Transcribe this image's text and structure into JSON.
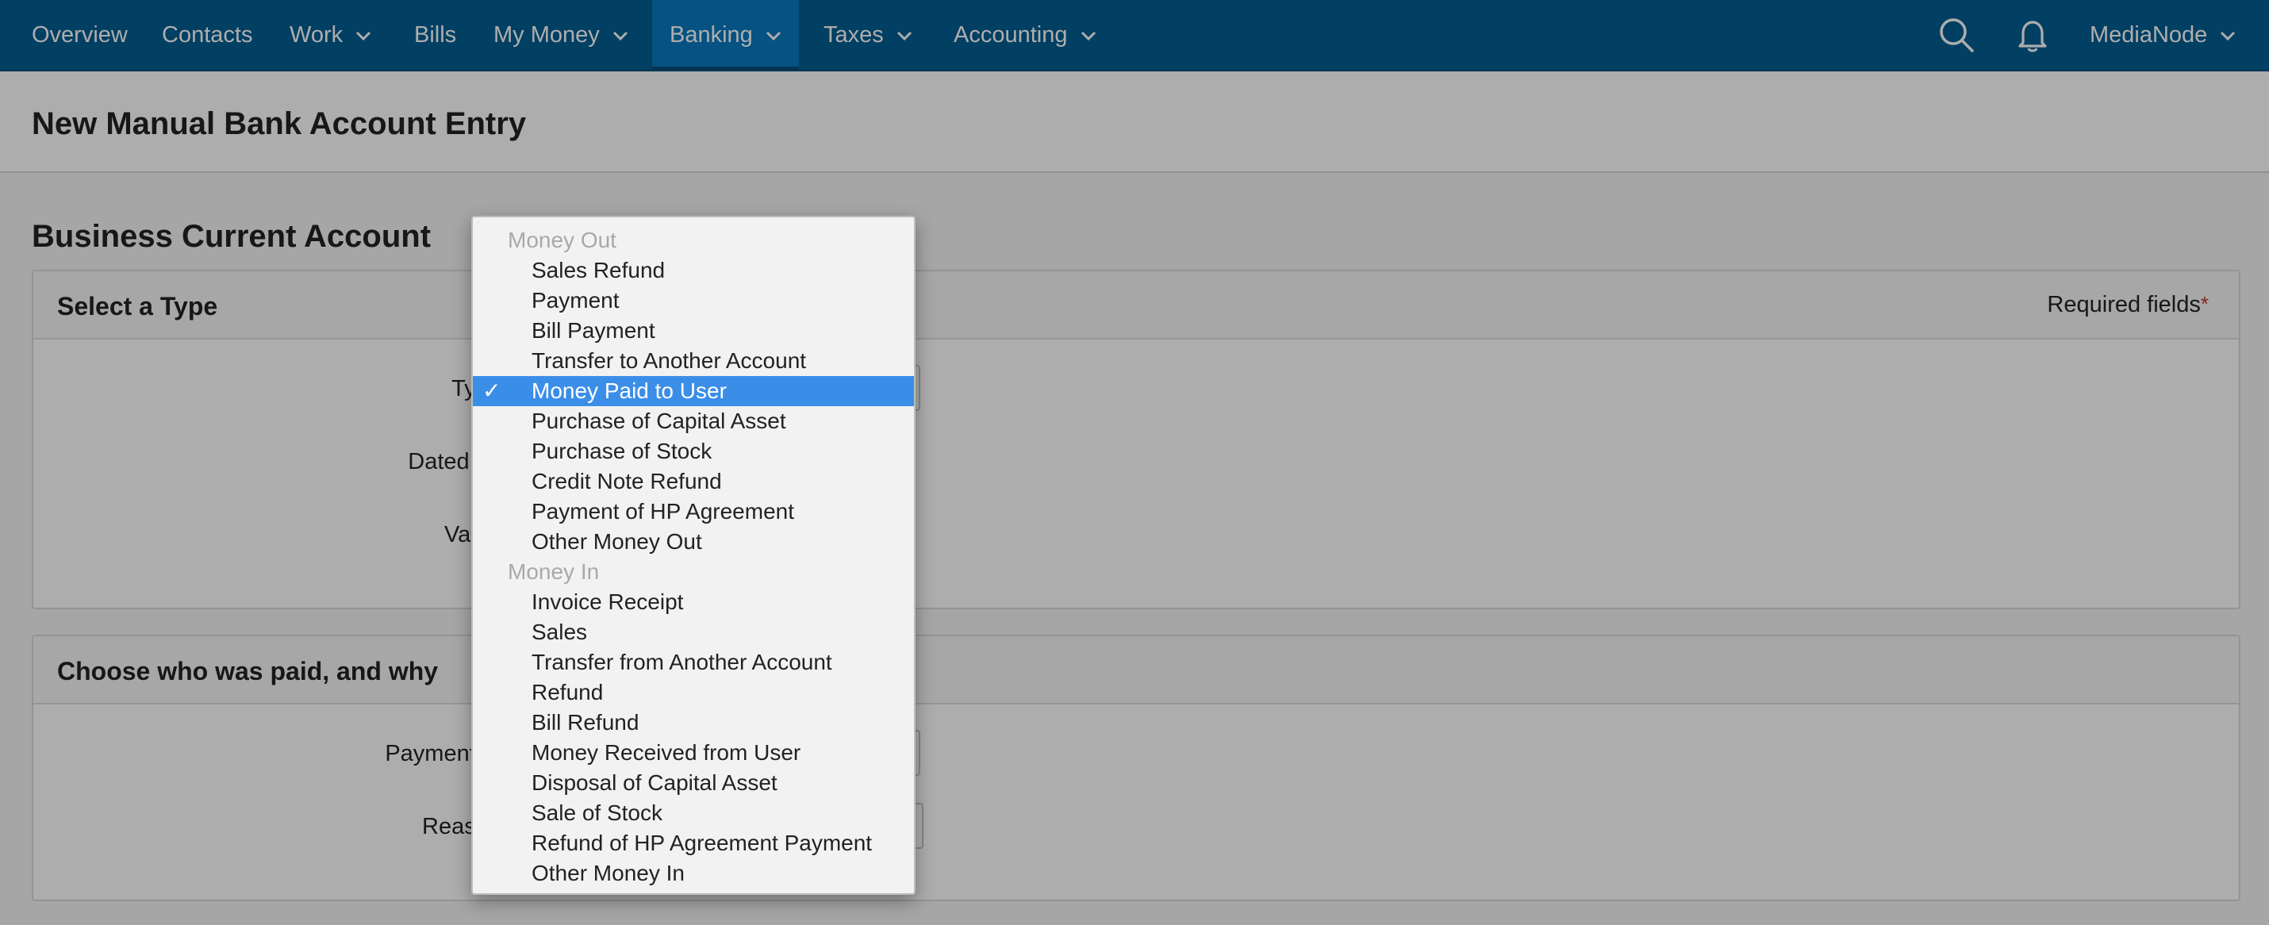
{
  "nav": {
    "items": [
      {
        "label": "Overview",
        "has_dropdown": false
      },
      {
        "label": "Contacts",
        "has_dropdown": false
      },
      {
        "label": "Work",
        "has_dropdown": true
      },
      {
        "label": "Bills",
        "has_dropdown": false
      },
      {
        "label": "My Money",
        "has_dropdown": true
      },
      {
        "label": "Banking",
        "has_dropdown": true,
        "active": true
      },
      {
        "label": "Taxes",
        "has_dropdown": true
      },
      {
        "label": "Accounting",
        "has_dropdown": true
      }
    ],
    "search_icon": "search-icon",
    "notification_icon": "bell-icon",
    "user": "MediaNode"
  },
  "page": {
    "title": "New Manual Bank Account Entry",
    "account": "Business Current Account"
  },
  "type_panel": {
    "title": "Select a Type",
    "required_label": "Required fields",
    "required_marker": "*",
    "fields": {
      "type_label": "Type",
      "dated_on_label": "Dated on",
      "value_label": "Value"
    }
  },
  "payee_panel": {
    "title": "Choose who was paid, and why",
    "fields": {
      "payment_to_label": "Payment to",
      "reason_label": "Reason"
    }
  },
  "type_dropdown": {
    "selected": "Money Paid to User",
    "check_mark": "✓",
    "groups": [
      {
        "label": "Money Out",
        "options": [
          "Sales Refund",
          "Payment",
          "Bill Payment",
          "Transfer to Another Account",
          "Money Paid to User",
          "Purchase of Capital Asset",
          "Purchase of Stock",
          "Credit Note Refund",
          "Payment of HP Agreement",
          "Other Money Out"
        ]
      },
      {
        "label": "Money In",
        "options": [
          "Invoice Receipt",
          "Sales",
          "Transfer from Another Account",
          "Refund",
          "Bill Refund",
          "Money Received from User",
          "Disposal of Capital Asset",
          "Sale of Stock",
          "Refund of HP Agreement Payment",
          "Other Money In"
        ]
      }
    ]
  },
  "colors": {
    "nav_bg": "#025d93",
    "nav_active": "#0a7ac0",
    "selection": "#3b8ee8",
    "required_star": "#c0392b"
  }
}
